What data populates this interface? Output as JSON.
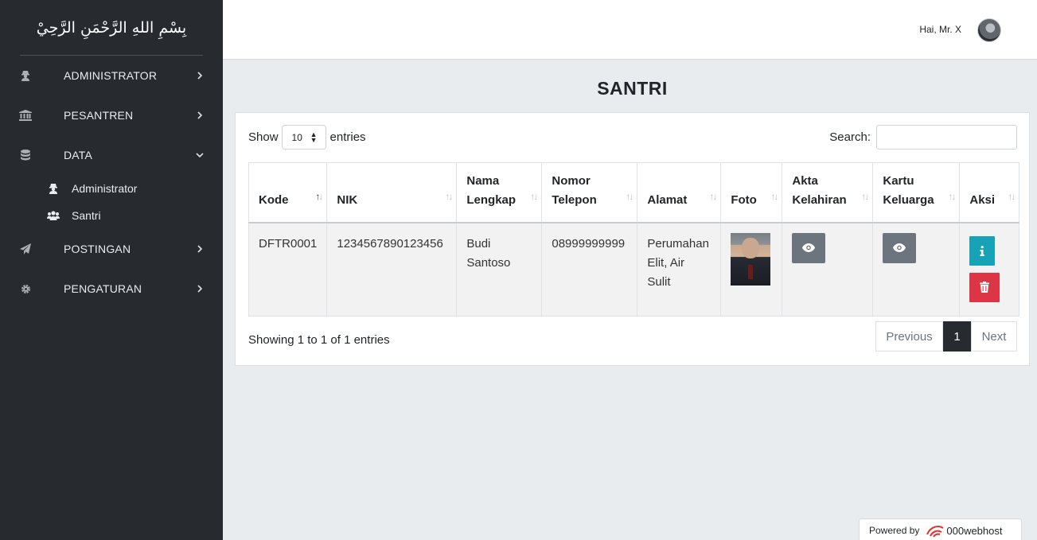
{
  "sidebar": {
    "brand": "بِسْمِ اللهِ الرَّحْمَنِ الرَّحِيْ",
    "menu": [
      {
        "label": "ADMINISTRATOR",
        "icon": "user-secret-icon"
      },
      {
        "label": "PESANTREN",
        "icon": "university-icon"
      },
      {
        "label": "DATA",
        "icon": "database-icon"
      },
      {
        "label": "POSTINGAN",
        "icon": "paper-plane-icon"
      },
      {
        "label": "PENGATURAN",
        "icon": "gear-icon"
      }
    ],
    "submenu": [
      {
        "label": "Administrator",
        "icon": "user-secret-icon"
      },
      {
        "label": "Santri",
        "icon": "users-icon"
      }
    ]
  },
  "topbar": {
    "greeting": "Hai, Mr. X"
  },
  "page": {
    "title": "SANTRI"
  },
  "table_controls": {
    "show_label": "Show",
    "page_length": "10",
    "entries_label": "entries",
    "search_label": "Search:",
    "search_value": ""
  },
  "table": {
    "headers": [
      [
        "Kode"
      ],
      [
        "NIK"
      ],
      [
        "Nama",
        "Lengkap"
      ],
      [
        "Nomor",
        "Telepon"
      ],
      [
        "Alamat"
      ],
      [
        "Foto"
      ],
      [
        "Akta",
        "Kelahiran"
      ],
      [
        "Kartu",
        "Keluarga"
      ],
      [
        "Aksi"
      ]
    ],
    "rows": [
      {
        "kode": "DFTR0001",
        "nik": "1234567890123456",
        "nama": [
          "Budi",
          "Santoso"
        ],
        "telepon": "08999999999",
        "alamat": [
          "Perumahan",
          "Elit, Air",
          "Sulit"
        ]
      }
    ]
  },
  "footer": {
    "info": "Showing 1 to 1 of 1 entries",
    "previous": "Previous",
    "page": "1",
    "next": "Next"
  },
  "powered": {
    "label": "Powered by",
    "brand": "000webhost"
  },
  "colors": {
    "sidebar": "#272b30",
    "info_button": "#17a2b8",
    "delete_button": "#dc3545",
    "view_button": "#6c757d"
  }
}
